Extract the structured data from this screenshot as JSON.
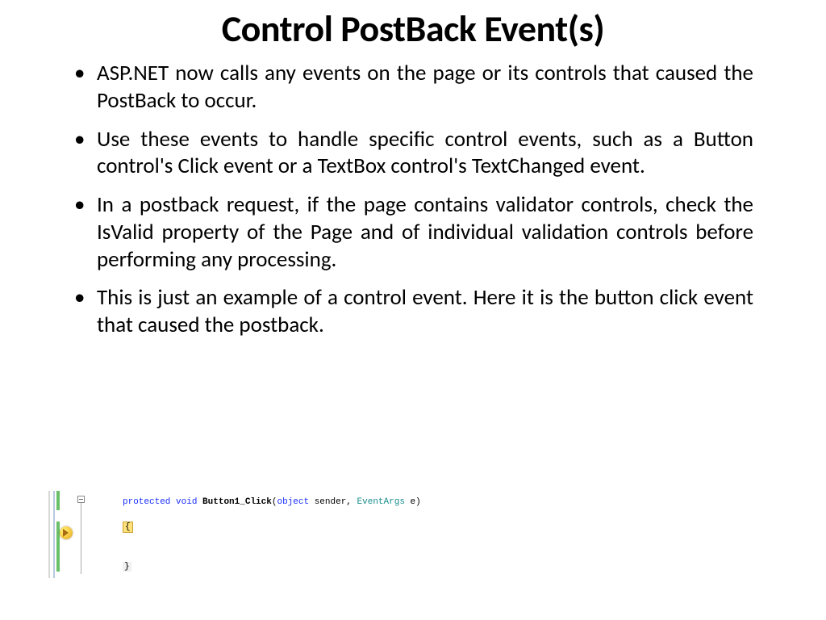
{
  "title": "Control PostBack Event(s)",
  "bullets": [
    "ASP.NET now calls any events on the page or its controls that caused the PostBack to occur.",
    "Use these events to handle specific control events, such as a Button control's Click event or a TextBox control's TextChanged event.",
    "In a postback request, if the page contains validator controls, check the IsValid property of the Page and of individual validation controls before performing any processing.",
    "This is just an example of a control event. Here it is the button click event that caused the postback."
  ],
  "code": {
    "kw_protected": "protected",
    "kw_void": "void",
    "method_name": "Button1_Click",
    "paren_open": "(",
    "kw_object": "object",
    "arg_sender": " sender, ",
    "type_eventargs": "EventArgs",
    "arg_e": " e",
    "paren_close": ")",
    "open_brace": "{",
    "close_brace": "}"
  }
}
